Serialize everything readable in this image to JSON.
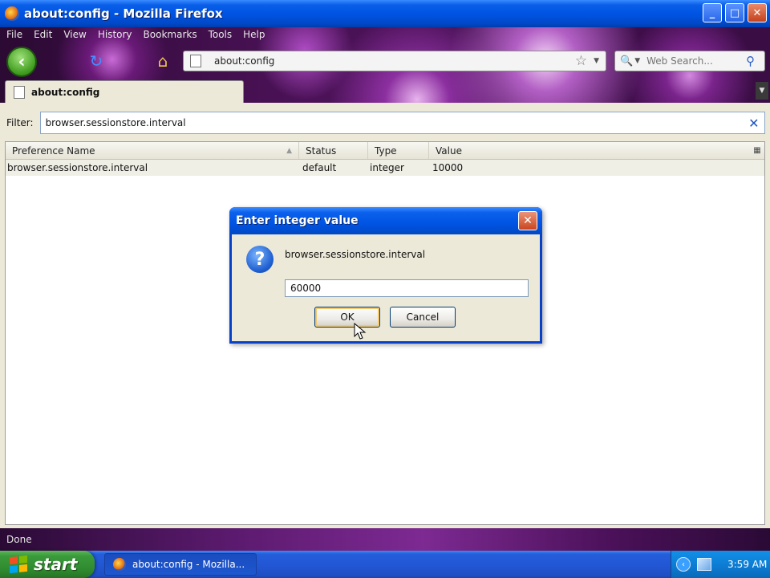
{
  "window": {
    "title": "about:config - Mozilla Firefox",
    "buttons": {
      "minimize": "_",
      "maximize": "□",
      "close": "✕"
    }
  },
  "menu": [
    "File",
    "Edit",
    "View",
    "History",
    "Bookmarks",
    "Tools",
    "Help"
  ],
  "navbar": {
    "url": "about:config",
    "search_placeholder": "Web Search..."
  },
  "tab": {
    "label": "about:config"
  },
  "filter": {
    "label": "Filter:",
    "value": "browser.sessionstore.interval"
  },
  "table": {
    "columns": [
      "Preference Name",
      "Status",
      "Type",
      "Value"
    ],
    "rows": [
      [
        "browser.sessionstore.interval",
        "default",
        "integer",
        "10000"
      ]
    ]
  },
  "dialog": {
    "title": "Enter integer value",
    "message": "browser.sessionstore.interval",
    "input_value": "60000",
    "ok_label": "OK",
    "cancel_label": "Cancel"
  },
  "status": {
    "text": "Done"
  },
  "taskbar": {
    "start_label": "start",
    "task_label": "about:config - Mozilla...",
    "clock": "3:59 AM"
  },
  "icons": {
    "back": "back-arrow-icon",
    "reload": "reload-icon",
    "home": "home-icon",
    "bookmark": "star-icon",
    "search_engine": "search-engine-icon",
    "search_go": "magnifier-icon",
    "clear": "clear-x-icon",
    "question": "question-icon"
  },
  "colors": {
    "title_blue": "#0054e3",
    "dialog_face": "#ece9d8",
    "persona_purple": "#7d2a92",
    "start_green": "#2f8a2f"
  }
}
